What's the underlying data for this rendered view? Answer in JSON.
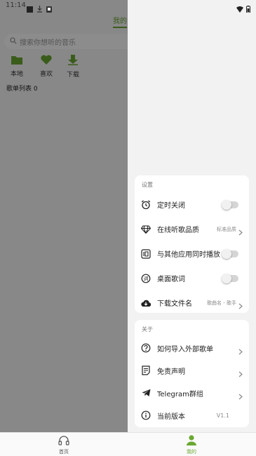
{
  "status_bar": {
    "time": "11:14"
  },
  "main": {
    "active_tab": "我的",
    "search_placeholder": "搜索你想听的音乐",
    "quick_items": [
      {
        "label": "本地",
        "icon": "folder-icon"
      },
      {
        "label": "喜欢",
        "icon": "heart-icon"
      },
      {
        "label": "下载",
        "icon": "download-icon"
      }
    ],
    "playlist_count": "歌单列表 0"
  },
  "drawer": {
    "settings": {
      "header": "设置",
      "items": [
        {
          "label": "定时关闭",
          "icon": "alarm-clock-icon",
          "control": "toggle",
          "on": false
        },
        {
          "label": "在线听歌品质",
          "icon": "diamond-icon",
          "control": "value",
          "value": "标准品质"
        },
        {
          "label": "与其他应用同时播放",
          "icon": "multi-play-icon",
          "control": "toggle",
          "on": false
        },
        {
          "label": "桌面歌词",
          "icon": "lyrics-icon",
          "control": "toggle",
          "on": false
        },
        {
          "label": "下载文件名",
          "icon": "cloud-download-icon",
          "control": "value",
          "value": "歌曲名 - 歌手"
        }
      ]
    },
    "about": {
      "header": "关于",
      "items": [
        {
          "label": "如何导入外部歌单",
          "icon": "help-circle-icon",
          "control": "chevron"
        },
        {
          "label": "免责声明",
          "icon": "document-icon",
          "control": "chevron"
        },
        {
          "label": "Telegram群组",
          "icon": "telegram-icon",
          "control": "chevron"
        },
        {
          "label": "当前版本",
          "icon": "info-icon",
          "control": "value",
          "value": "V1.1"
        }
      ]
    }
  },
  "bottom_nav": [
    {
      "label": "首页",
      "icon": "headphones-icon",
      "active": false
    },
    {
      "label": "我的",
      "icon": "person-icon",
      "active": true
    }
  ],
  "colors": {
    "accent": "#6aa832",
    "inactive": "#555555"
  }
}
